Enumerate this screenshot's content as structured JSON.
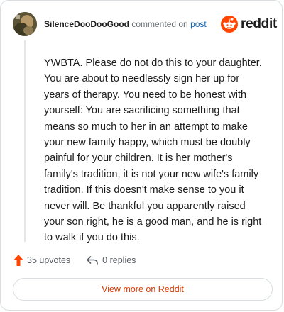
{
  "header": {
    "username": "SilenceDooDooGood",
    "commented_on": "commented on",
    "post_link": "post",
    "brand_name": "reddit"
  },
  "comment": {
    "body": "YWBTA. Please do not do this to your daughter. You are about to needlessly sign her up for years of therapy. You need to be honest with yourself: You are sacrificing something that means so much to her in an attempt to make your new family happy, which must be doubly painful for your children. It is her mother's family's tradition, it is not your new wife's family tradition. If this doesn't make sense to you it never will. Be thankful you apparently raised your son right, he is a good man, and he is right to walk if you do this."
  },
  "actions": {
    "upvotes": "35 upvotes",
    "replies": "0 replies"
  },
  "footer": {
    "view_more": "View more on Reddit"
  },
  "colors": {
    "brand_orange": "#ff4500",
    "upvote_arrow": "#ff4500",
    "view_more_text": "#d93a00",
    "post_link": "#0a66c2"
  },
  "icons": {
    "avatar": "user-avatar",
    "brand": "reddit-snoo-icon",
    "upvote": "upvote-arrow-icon",
    "reply": "reply-arrow-icon"
  }
}
